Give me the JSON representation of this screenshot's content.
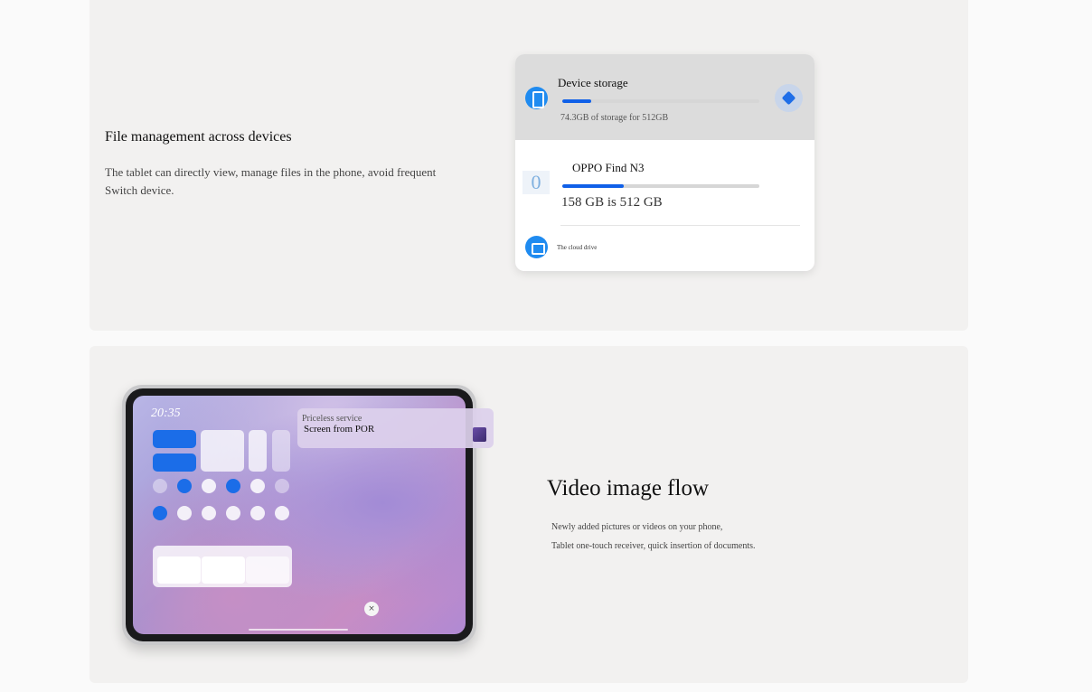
{
  "section1": {
    "title": "File management across devices",
    "desc_line1": "The tablet can directly view, manage files in the phone, avoid frequent",
    "desc_line2": "Switch device.",
    "panel": {
      "device_storage": {
        "label": "Device storage",
        "subtext": "74.3GB of storage for 512GB",
        "usage_fraction": 0.145
      },
      "oppo_device": {
        "icon_text": "0",
        "label": "OPPO Find N3",
        "subtext": "158 GB is 512 GB",
        "usage_fraction": 0.31
      },
      "cloud": {
        "label": "The cloud drive"
      }
    }
  },
  "section2": {
    "title": "Video image flow",
    "desc_line1": "Newly added pictures or videos on your phone,",
    "desc_line2": "Tablet one-touch receiver, quick insertion of documents.",
    "tablet": {
      "time": "20:35",
      "popup_title": "Priceless service",
      "popup_subtitle": "Screen from POR",
      "close_symbol": "×"
    }
  },
  "colors": {
    "accent_blue": "#1f8bf0",
    "progress_blue": "#1060e8",
    "card_bg": "#f2f1f0"
  }
}
